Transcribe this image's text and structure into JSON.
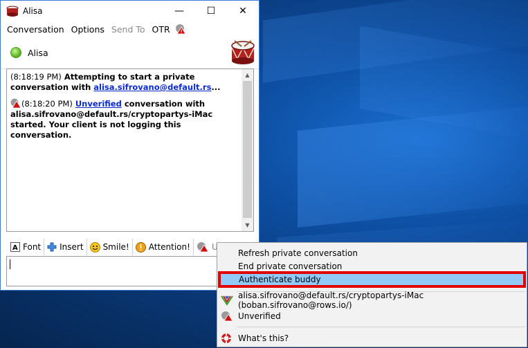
{
  "window": {
    "title": "Alisa",
    "controls": {
      "minimize": "—",
      "maximize": "☐",
      "close": "✕"
    }
  },
  "menubar": {
    "conversation": "Conversation",
    "options": "Options",
    "send_to": "Send To",
    "otr": "OTR"
  },
  "buddy": {
    "name": "Alisa",
    "status_color": "#5fb82a"
  },
  "conversation": {
    "msg1": {
      "time": "(8:18:19 PM)",
      "text": "Attempting to start a private conversation with",
      "link": "alisa.sifrovano@default.rs",
      "ellipsis": "..."
    },
    "msg2": {
      "time": "(8:18:20 PM)",
      "link": "Unverified",
      "text": "conversation with alisa.sifrovano@default.rs/cryptopartys-iMac started.  Your client is not logging this conversation."
    }
  },
  "toolbar": {
    "font": "Font",
    "insert": "Insert",
    "smile": "Smile!",
    "attention": "Attention!",
    "otr_status": "Unverified"
  },
  "context_menu": {
    "refresh": "Refresh private conversation",
    "end": "End private conversation",
    "authenticate": "Authenticate buddy",
    "account": "alisa.sifrovano@default.rs/cryptopartys-iMac (boban.sifrovano@rows.io/)",
    "status": "Unverified",
    "whats_this": "What's this?"
  },
  "colors": {
    "highlight": "#91c9f7",
    "highlight_border": "#e00000",
    "link": "#0a2ad0"
  }
}
